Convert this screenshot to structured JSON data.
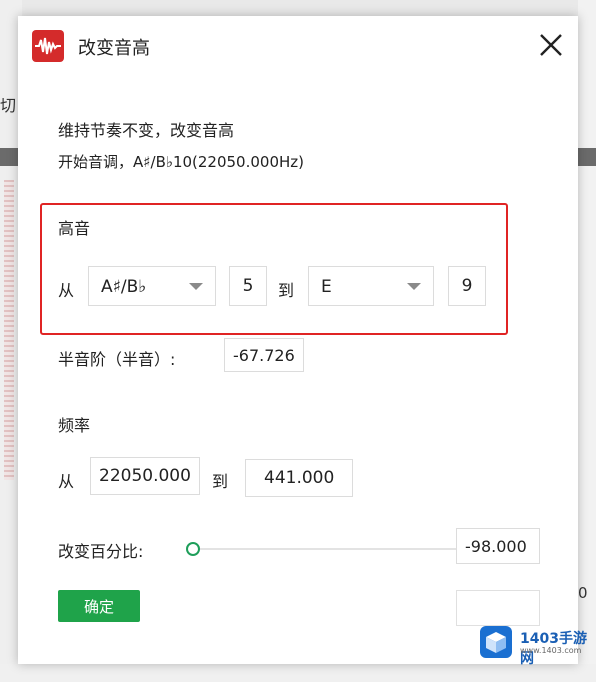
{
  "background": {
    "left_fragment": "切",
    "right_fragment": "0"
  },
  "dialog": {
    "title": "改变音高",
    "app_icon": "waveform-icon",
    "close_icon": "close-icon",
    "info_line1": "维持节奏不变，改变音高",
    "info_line2": "开始音调，A♯/B♭10(22050.000Hz)",
    "pitch_section": {
      "label": "高音",
      "from_label": "从",
      "from_note": "A♯/B♭",
      "from_octave": "5",
      "to_label": "到",
      "to_note": "E",
      "to_octave": "9"
    },
    "semitone_label": "半音阶（半音）:",
    "semitone_value": "-67.726",
    "frequency_section": {
      "label": "频率",
      "from_label": "从",
      "from_value": "22050.000",
      "to_label": "到",
      "to_value": "441.000"
    },
    "percent_label": "改变百分比:",
    "percent_value": "-98.000",
    "percent_slider_level": 0.0,
    "ok_label": "确定",
    "accent_color": "#1fa34a",
    "highlight_color": "#e02424"
  },
  "watermark": {
    "brand": "1403手游网",
    "domain": "www.1403.com",
    "icon": "cube-logo-icon"
  }
}
